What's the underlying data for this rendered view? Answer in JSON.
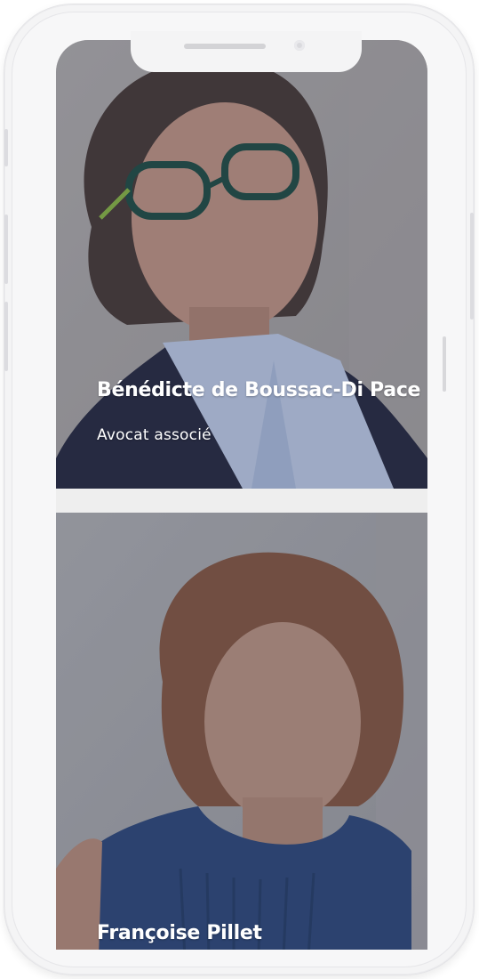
{
  "team": {
    "members": [
      {
        "name": "Bénédicte de Boussac-Di Pace",
        "role": "Avocat associé"
      },
      {
        "name": "Françoise Pillet"
      }
    ]
  },
  "colors": {
    "overlay": "#263054",
    "text": "#ffffff",
    "frame": "#f4f4f5"
  }
}
